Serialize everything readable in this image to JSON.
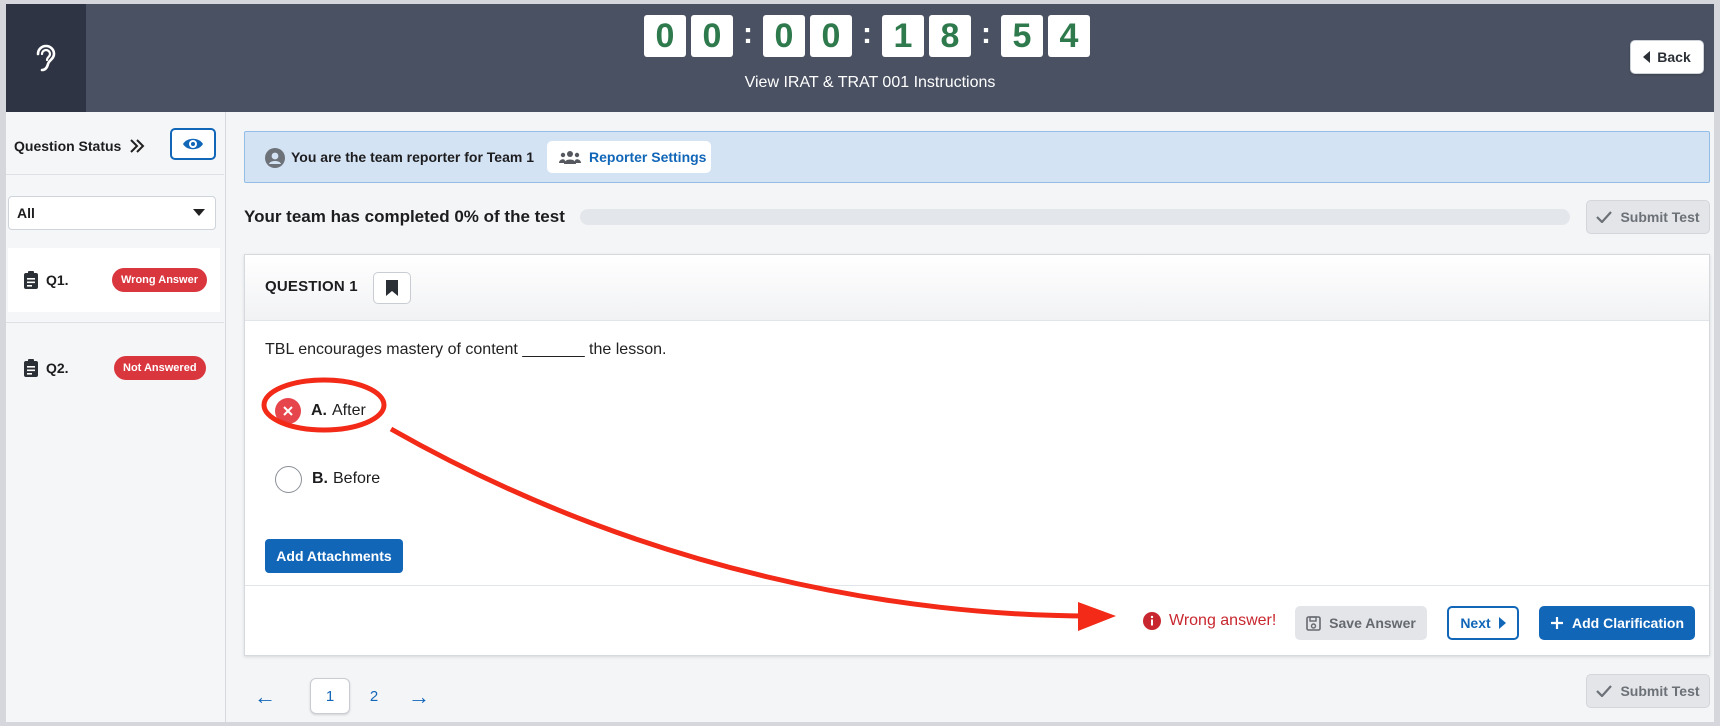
{
  "header": {
    "timer": {
      "digits": [
        "0",
        "0",
        "0",
        "0",
        "1",
        "8",
        "5",
        "4"
      ],
      "separator": ":"
    },
    "instructions_link": "View IRAT & TRAT 001 Instructions",
    "back_label": "Back",
    "logo_icon": "ear-icon"
  },
  "sidebar": {
    "title": "Question Status",
    "filter_value": "All",
    "questions": [
      {
        "label": "Q1.",
        "status": "Wrong Answer",
        "active": true
      },
      {
        "label": "Q2.",
        "status": "Not Answered",
        "active": false
      }
    ]
  },
  "banner": {
    "reporter_text": "You are the team reporter for Team 1",
    "settings_label": "Reporter Settings"
  },
  "progress": {
    "title": "Your team has completed 0% of the test",
    "percent": 0,
    "submit_label": "Submit Test"
  },
  "question": {
    "number_label": "QUESTION 1",
    "stem": "TBL encourages mastery of content _______ the lesson.",
    "options": [
      {
        "letter": "A.",
        "text": "After",
        "state": "wrong"
      },
      {
        "letter": "B.",
        "text": "Before",
        "state": "unselected"
      }
    ],
    "attachments_label": "Add Attachments",
    "feedback": "Wrong answer!",
    "save_label": "Save Answer",
    "next_label": "Next",
    "clarification_label": "Add Clarification"
  },
  "pagination": {
    "pages": [
      "1",
      "2"
    ],
    "current": "1",
    "prev": "←",
    "next": "→"
  },
  "bottom_submit_label": "Submit Test",
  "colors": {
    "accent": "#1166b8",
    "timer_digit": "#2f7a4d",
    "error": "#d9363e",
    "header_bg": "#4a5162",
    "annotation": "#f22a17"
  }
}
